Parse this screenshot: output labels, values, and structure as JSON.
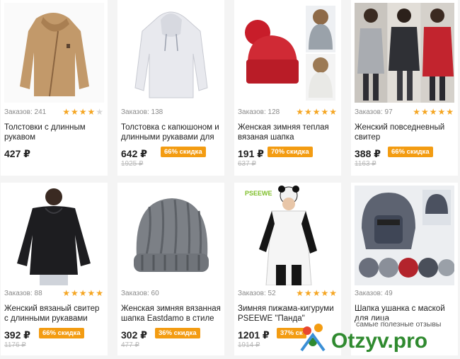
{
  "products": [
    {
      "orders": "Заказов: 241",
      "rating": 4,
      "title": "Толстовки с длинным рукавом",
      "price": "427 ₽",
      "old_price": "",
      "discount": "",
      "image": "tan-zip-hoodie"
    },
    {
      "orders": "Заказов: 138",
      "rating": 0,
      "title": "Толстовка с капюшоном и длинными рукавами для",
      "price": "642 ₽",
      "old_price": "1925 ₽",
      "discount": "66% скидка",
      "image": "white-hoodie"
    },
    {
      "orders": "Заказов: 128",
      "rating": 5,
      "title": "Женская зимняя теплая вязаная шапка",
      "price": "191 ₽",
      "old_price": "637 ₽",
      "discount": "70% скидка",
      "image": "red-pompom-beanie"
    },
    {
      "orders": "Заказов: 97",
      "rating": 5,
      "title": "Женский повседневный свитер",
      "price": "388 ₽",
      "old_price": "1163 ₽",
      "discount": "66% скидка",
      "image": "women-sweaters-collage"
    },
    {
      "orders": "Заказов: 88",
      "rating": 5,
      "title": "Женский вязаный свитер с длинными рукавами",
      "price": "392 ₽",
      "old_price": "1176 ₽",
      "discount": "66% скидка",
      "image": "black-knit-sweater"
    },
    {
      "orders": "Заказов: 60",
      "rating": 0,
      "title": "Женская зимняя вязанная шапка Eastdamo в стиле",
      "price": "302 ₽",
      "old_price": "477 ₽",
      "discount": "36% скидка",
      "image": "grey-chunky-beanie"
    },
    {
      "orders": "Заказов: 52",
      "rating": 5,
      "title": "Зимняя пижама-кигуруми PSEEWE \"Панда\"",
      "price": "1201 ₽",
      "old_price": "1914 ₽",
      "discount": "37% ск",
      "image": "panda-kigurumi",
      "image_brand": "PSEEWE"
    },
    {
      "orders": "Заказов: 49",
      "rating": 0,
      "title": "Шапка ушанка с маской для лица",
      "price": "",
      "old_price": "",
      "discount": "",
      "image": "ushanka-face-mask"
    }
  ],
  "watermark": {
    "caption": "самые полезные отзывы",
    "logo_text": "Otzyv.pro",
    "brand_color": "#2f8a2f",
    "accent_color": "#f39c12"
  },
  "colors": {
    "badge": "#f39c12",
    "star": "#f5a623",
    "star_off": "#d6d6d6"
  }
}
